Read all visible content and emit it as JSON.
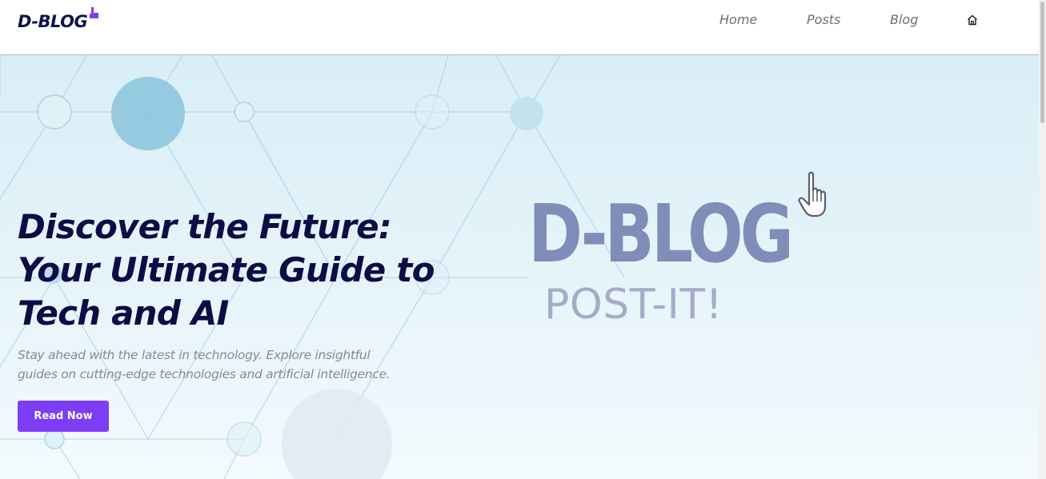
{
  "header": {
    "logo": "D-BLOG",
    "nav": [
      {
        "label": "Home"
      },
      {
        "label": "Posts"
      },
      {
        "label": "Blog"
      }
    ],
    "home_icon": "home-icon"
  },
  "hero": {
    "title_lines": [
      "Discover the Future:",
      "Your Ultimate Guide to",
      "Tech and AI"
    ],
    "subtitle_lines": [
      "Stay ahead with the latest in technology. Explore insightful",
      "guides on cutting-edge technologies and artificial intelligence."
    ],
    "button_label": "Read Now",
    "brand": "D-BLOG",
    "tagline": "POST-IT!",
    "cursor_icon": "hand-pointer-icon"
  },
  "colors": {
    "accent": "#7d3cf5",
    "title": "#0d0c45",
    "brand": "#7f8db8"
  }
}
